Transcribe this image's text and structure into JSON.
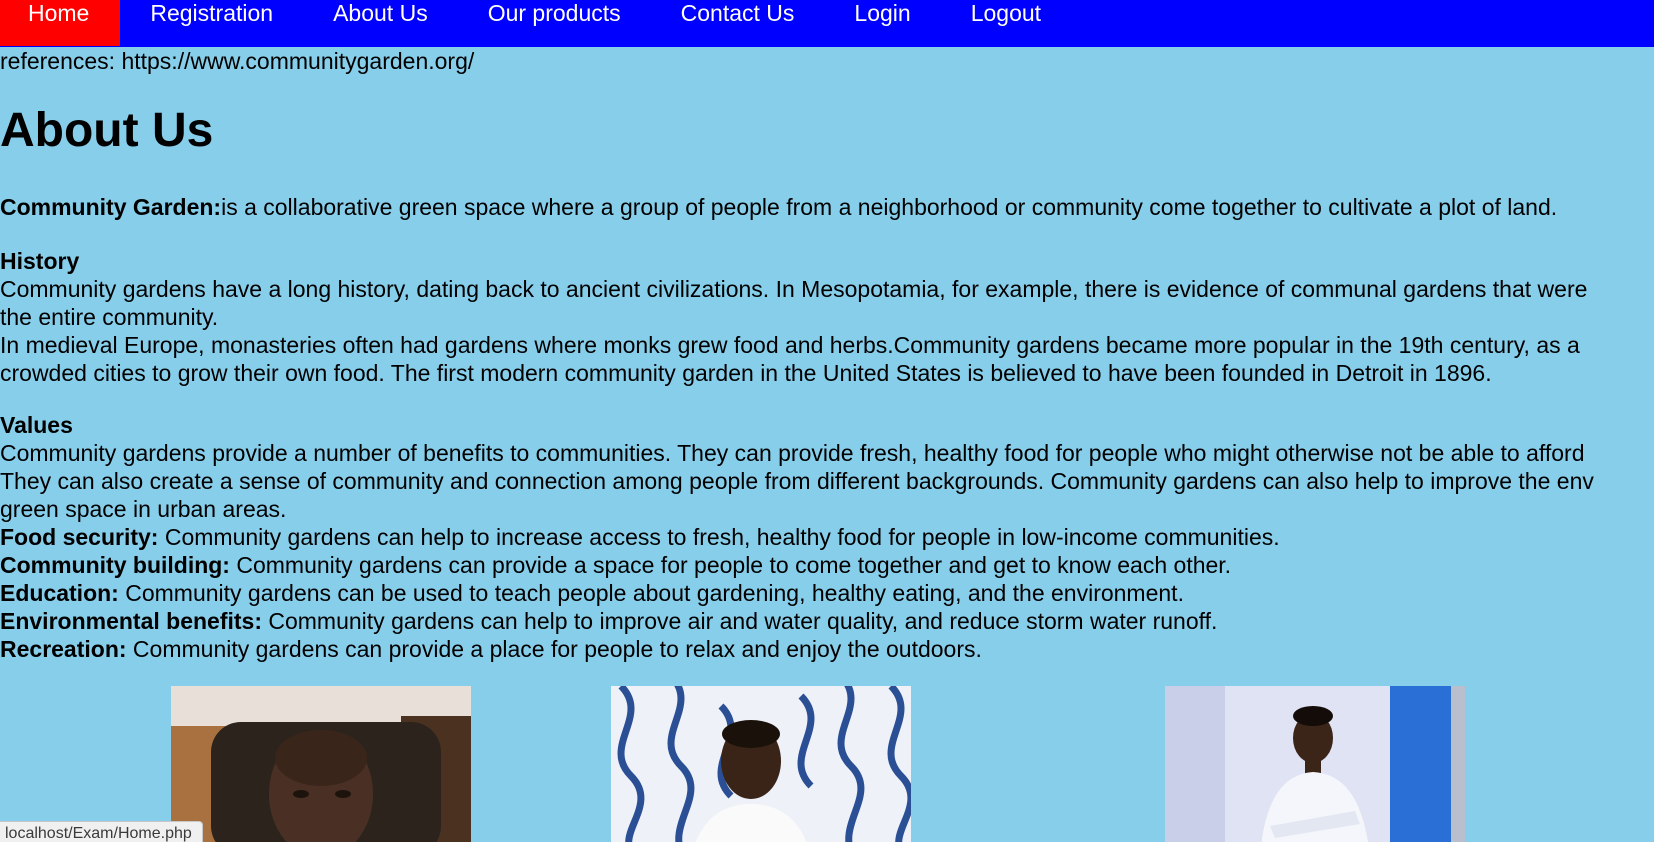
{
  "nav": {
    "items": [
      {
        "label": "Home",
        "active": true
      },
      {
        "label": "Registration",
        "active": false
      },
      {
        "label": "About Us",
        "active": false
      },
      {
        "label": "Our products",
        "active": false
      },
      {
        "label": "Contact Us",
        "active": false
      },
      {
        "label": "Login",
        "active": false
      },
      {
        "label": "Logout",
        "active": false
      }
    ],
    "colors": {
      "bar": "#0000ff",
      "active": "#ff0000",
      "text": "#ffffff"
    }
  },
  "references": "references: https://www.communitygarden.org/",
  "page_title": "About Us",
  "intro": {
    "term": "Community Garden:",
    "text": "is a collaborative green space where a group of people from a neighborhood or community come together to cultivate a plot of land."
  },
  "history": {
    "heading": "History",
    "lines": [
      "Community gardens have a long history, dating back to ancient civilizations. In Mesopotamia, for example, there is evidence of communal gardens that were",
      "the entire community.",
      "In medieval Europe, monasteries often had gardens where monks grew food and herbs.Community gardens became more popular in the 19th century, as a",
      "crowded cities to grow their own food. The first modern community garden in the United States is believed to have been founded in Detroit in 1896."
    ]
  },
  "values": {
    "heading": "Values",
    "lines": [
      "Community gardens provide a number of benefits to communities. They can provide fresh, healthy food for people who might otherwise not be able to afford",
      "They can also create a sense of community and connection among people from different backgrounds. Community gardens can also help to improve the env",
      "green space in urban areas."
    ],
    "benefits": [
      {
        "term": "Food security:",
        "text": " Community gardens can help to increase access to fresh, healthy food for people in low-income communities."
      },
      {
        "term": "Community building:",
        "text": " Community gardens can provide a space for people to come together and get to know each other."
      },
      {
        "term": "Education:",
        "text": " Community gardens can be used to teach people about gardening, healthy eating, and the environment."
      },
      {
        "term": "Environmental benefits:",
        "text": " Community gardens can help to improve air and water quality, and reduce storm water runoff."
      },
      {
        "term": "Recreation:",
        "text": " Community gardens can provide a place for people to relax and enjoy the outdoors."
      }
    ]
  },
  "status_bar": {
    "url": "localhost/Exam/Home.php"
  },
  "colors": {
    "page_background": "#87ceeb"
  }
}
